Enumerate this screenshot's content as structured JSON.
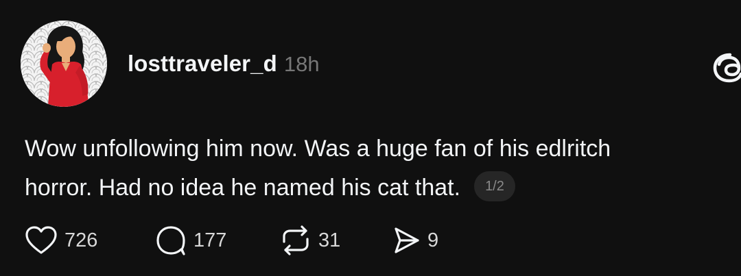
{
  "post": {
    "username": "losttraveler_d",
    "timestamp": "18h",
    "text_line_1": "Wow unfollowing him now. Was a huge fan of his edlritch",
    "text_line_2": "horror. Had no idea he named his cat that.",
    "page_indicator": "1/2"
  },
  "actions": {
    "likes": "726",
    "replies": "177",
    "reposts": "31",
    "shares": "9"
  },
  "icons": {
    "like": "heart-icon",
    "reply": "speech-bubble-icon",
    "repost": "repost-arrows-icon",
    "share": "send-icon",
    "brand": "threads-logo-icon"
  },
  "colors": {
    "background": "#101010",
    "text": "#f3f5f7",
    "muted": "#777777",
    "avatar_shirt": "#d7202c"
  }
}
